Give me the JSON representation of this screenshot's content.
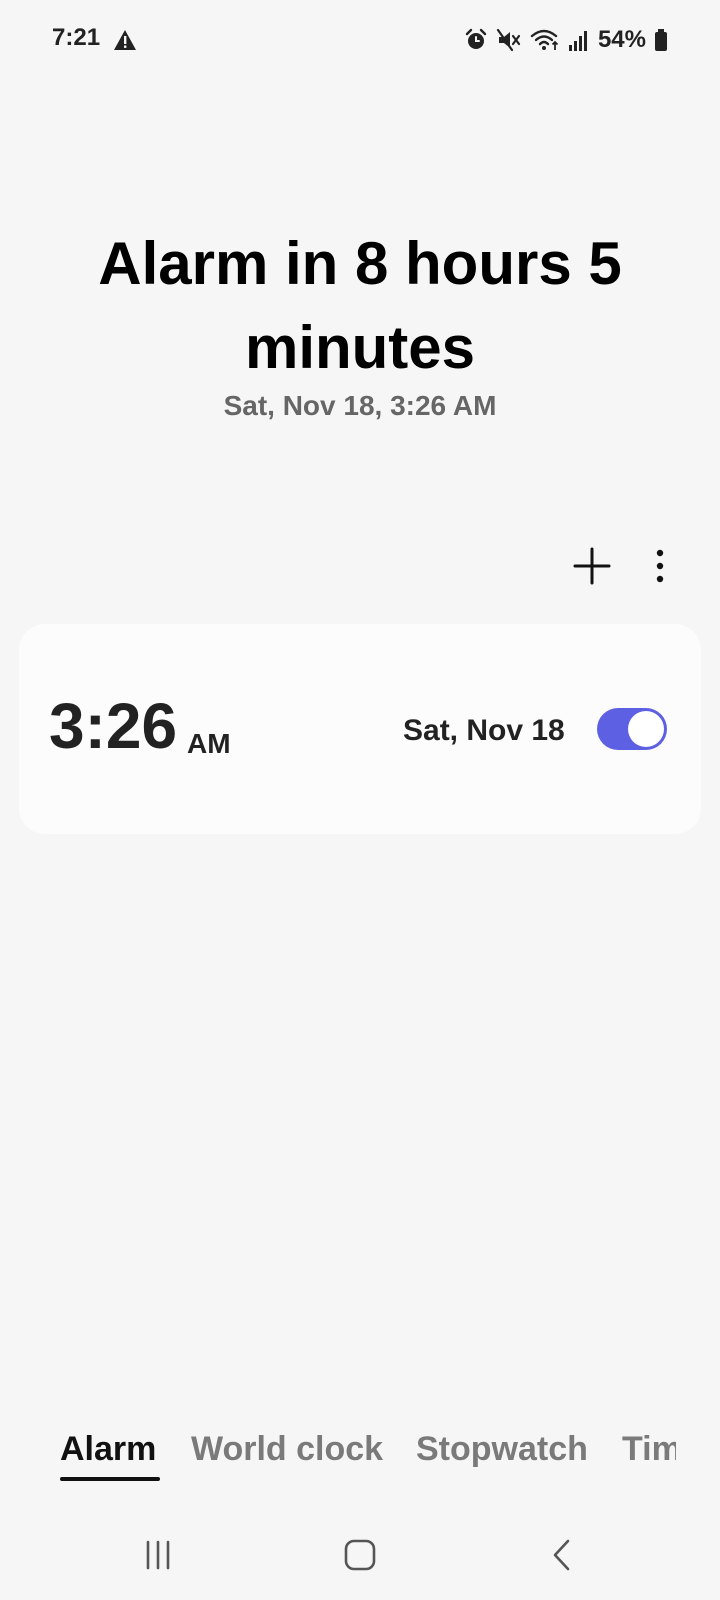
{
  "status_bar": {
    "time": "7:21",
    "battery": "54%",
    "icons": [
      "warning-icon",
      "alarm-icon",
      "mute-icon",
      "wifi-icon",
      "signal-icon",
      "battery-icon"
    ]
  },
  "header": {
    "headline": "Alarm in 8 hours 5 minutes",
    "subline": "Sat, Nov 18, 3:26 AM"
  },
  "toolbar": {
    "add_icon": "plus-icon",
    "more_icon": "more-vertical-icon"
  },
  "alarm": {
    "time": "3:26",
    "ampm": "AM",
    "date": "Sat, Nov 18",
    "enabled": true
  },
  "tabs": [
    {
      "label": "Alarm",
      "active": true
    },
    {
      "label": "World clock",
      "active": false
    },
    {
      "label": "Stopwatch",
      "active": false
    },
    {
      "label": "Timer",
      "active": false
    }
  ],
  "colors": {
    "accent": "#5e60e4",
    "background": "#f6f6f6",
    "card": "#fcfcfc"
  },
  "nav": {
    "icons": [
      "recent-apps-icon",
      "home-icon",
      "back-icon"
    ]
  }
}
